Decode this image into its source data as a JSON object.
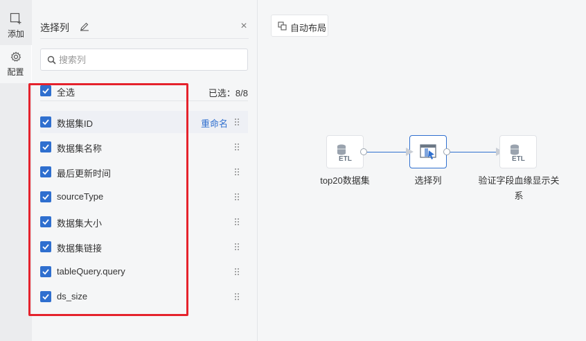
{
  "rail": {
    "add_label": "添加",
    "config_label": "配置"
  },
  "panel": {
    "title": "选择列",
    "search_placeholder": "搜索列",
    "select_all_label": "全选",
    "selected_count": "已选：8/8",
    "rename_label": "重命名",
    "columns": [
      {
        "label": "数据集ID",
        "checked": true
      },
      {
        "label": "数据集名称",
        "checked": true
      },
      {
        "label": "最后更新时间",
        "checked": true
      },
      {
        "label": "sourceType",
        "checked": true
      },
      {
        "label": "数据集大小",
        "checked": true
      },
      {
        "label": "数据集链接",
        "checked": true
      },
      {
        "label": "tableQuery.query",
        "checked": true
      },
      {
        "label": "ds_size",
        "checked": true
      }
    ]
  },
  "canvas": {
    "auto_layout_label": "自动布局",
    "nodes": [
      {
        "label": "top20数据集",
        "icon": "etl-icon"
      },
      {
        "label": "选择列",
        "icon": "select-columns-icon"
      },
      {
        "label_line1": "验证字段血缘显示关",
        "label_line2": "系",
        "icon": "etl-icon"
      }
    ]
  },
  "colors": {
    "accent": "#2f6fcf",
    "highlight": "#e5222c"
  }
}
